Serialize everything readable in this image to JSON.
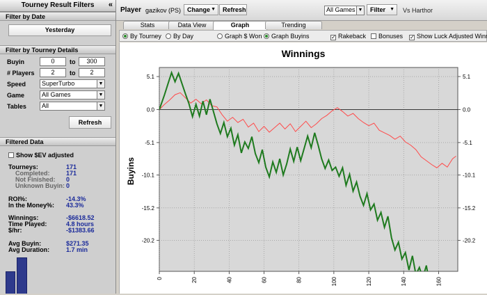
{
  "left": {
    "title": "Tourney Result Filters",
    "collapse_glyph": "«",
    "filter_by_date": {
      "header": "Filter by Date",
      "button": "Yesterday"
    },
    "filter_by_details": {
      "header": "Filter by Tourney Details",
      "buyin": {
        "label": "Buyin",
        "from": "0",
        "to_label": "to",
        "to": "300"
      },
      "players": {
        "label": "# Players",
        "from": "2",
        "to_label": "to",
        "to": "2"
      },
      "speed": {
        "label": "Speed",
        "value": "SuperTurbo"
      },
      "game": {
        "label": "Game",
        "value": "All Games"
      },
      "tables": {
        "label": "Tables",
        "value": "All"
      },
      "refresh": "Refresh"
    },
    "filtered": {
      "header": "Filtered Data",
      "show_ev_label": "Show $EV adjusted",
      "tourneys": {
        "label": "Tourneys:",
        "value": "171"
      },
      "completed": {
        "label": "Completed:",
        "value": "171"
      },
      "not_finished": {
        "label": "Not Finished:",
        "value": "0"
      },
      "unknown_buyin": {
        "label": "Unknown Buyin:",
        "value": "0"
      },
      "roi": {
        "label": "ROI%:",
        "value": "-14.3%"
      },
      "itm": {
        "label": "In the Money%:",
        "value": "43.3%"
      },
      "winnings": {
        "label": "Winnings:",
        "value": "-$6618.52"
      },
      "time_played": {
        "label": "Time Played:",
        "value": "4.8 hours"
      },
      "per_hour": {
        "label": "$/hr:",
        "value": "-$1383.66"
      },
      "avg_buyin": {
        "label": "Avg Buyin:",
        "value": "$271.35"
      },
      "avg_duration": {
        "label": "Avg Duration:",
        "value": "1.7 min"
      }
    }
  },
  "topbar": {
    "player_label": "Player",
    "player_name": "gazikov (PS)",
    "change": "Change",
    "refresh": "Refresh",
    "games": "All Games",
    "filter": "Filter",
    "vs": "Vs Harthor"
  },
  "tabs": [
    {
      "label": "Stats"
    },
    {
      "label": "Data View"
    },
    {
      "label": "Graph"
    },
    {
      "label": "Trending"
    }
  ],
  "options": {
    "by_tourney": "By Tourney",
    "by_day": "By Day",
    "graph_won": "Graph $ Won",
    "graph_buyins": "Graph Buyins",
    "rakeback": "Rakeback",
    "bonuses": "Bonuses",
    "luck": "Show Luck Adjusted Winnings"
  },
  "colors": {
    "actual_line": "#1e7a1e",
    "luck_line": "#ff4a4a",
    "plot_bg": "#d8d8d8",
    "value_text": "#1a2a9a"
  },
  "chart_data": {
    "type": "line",
    "title": "Winnings",
    "ylabel": "Buyins",
    "xlabel": "",
    "xlim": [
      0,
      171
    ],
    "ylim": [
      -25,
      6.5
    ],
    "xticks": [
      0,
      20,
      40,
      60,
      80,
      100,
      120,
      140,
      160
    ],
    "yticks": [
      5.1,
      0.0,
      -5.1,
      -10.1,
      -15.2,
      -20.2
    ],
    "ytick_labels": [
      "5.1",
      "0.0",
      "-5.1",
      "-10.1",
      "-15.2",
      "-20.2"
    ],
    "grid": true,
    "series": [
      {
        "color": "#1e7a1e",
        "x": [
          0,
          3,
          5,
          7,
          9,
          11,
          13,
          15,
          17,
          19,
          21,
          23,
          25,
          27,
          29,
          31,
          33,
          35,
          37,
          39,
          41,
          43,
          45,
          47,
          49,
          51,
          53,
          55,
          57,
          59,
          61,
          63,
          65,
          67,
          69,
          71,
          73,
          75,
          77,
          79,
          81,
          83,
          85,
          87,
          89,
          91,
          93,
          95,
          97,
          99,
          101,
          103,
          105,
          107,
          109,
          111,
          113,
          115,
          117,
          119,
          121,
          123,
          125,
          127,
          129,
          131,
          133,
          135,
          137,
          139,
          141,
          143,
          145,
          147,
          149,
          151,
          153,
          155,
          157,
          159,
          161,
          163,
          165,
          167,
          170
        ],
        "y": [
          0.0,
          2.3,
          4.0,
          5.7,
          4.3,
          5.6,
          4.0,
          2.4,
          0.9,
          -1.1,
          0.8,
          -1.0,
          1.3,
          -0.8,
          1.6,
          -0.3,
          -2.2,
          -3.7,
          -2.0,
          -4.2,
          -2.9,
          -5.5,
          -3.9,
          -6.7,
          -5.0,
          -6.0,
          -4.2,
          -6.8,
          -8.2,
          -6.2,
          -8.9,
          -10.4,
          -8.1,
          -9.7,
          -7.6,
          -10.1,
          -8.4,
          -6.1,
          -8.0,
          -5.8,
          -7.9,
          -6.0,
          -4.1,
          -5.9,
          -3.6,
          -5.5,
          -7.6,
          -9.1,
          -7.8,
          -9.4,
          -8.9,
          -10.3,
          -9.0,
          -11.7,
          -10.0,
          -12.6,
          -11.2,
          -13.4,
          -14.8,
          -13.0,
          -15.5,
          -14.6,
          -17.1,
          -15.9,
          -18.2,
          -16.5,
          -19.8,
          -21.7,
          -20.5,
          -23.1,
          -22.1,
          -24.8,
          -22.6,
          -25.5,
          -24.4,
          -26.0,
          -24.1,
          -27.1,
          -25.6,
          -27.8,
          -26.3,
          -28.6,
          -27.3,
          -29.0,
          -27.8
        ],
        "name": ""
      },
      {
        "color": "#ff4a4a",
        "x": [
          0,
          3,
          6,
          9,
          12,
          15,
          18,
          21,
          24,
          27,
          30,
          33,
          36,
          39,
          42,
          45,
          48,
          51,
          54,
          57,
          60,
          63,
          66,
          69,
          72,
          75,
          78,
          81,
          84,
          87,
          90,
          93,
          96,
          99,
          102,
          105,
          108,
          111,
          114,
          117,
          120,
          123,
          126,
          129,
          132,
          135,
          138,
          141,
          144,
          147,
          150,
          153,
          156,
          159,
          162,
          165,
          168,
          170
        ],
        "y": [
          0.0,
          0.8,
          1.5,
          2.3,
          2.6,
          1.8,
          1.0,
          1.6,
          0.9,
          1.5,
          0.6,
          0.4,
          -0.8,
          -1.8,
          -1.2,
          -2.0,
          -1.5,
          -2.7,
          -2.1,
          -3.4,
          -2.6,
          -3.5,
          -2.8,
          -2.1,
          -3.0,
          -2.2,
          -3.4,
          -2.6,
          -1.8,
          -2.8,
          -2.2,
          -1.4,
          -0.9,
          -0.2,
          0.3,
          -0.3,
          -1.0,
          -0.6,
          -1.4,
          -2.0,
          -2.5,
          -2.1,
          -3.2,
          -3.6,
          -4.0,
          -4.6,
          -4.1,
          -5.0,
          -5.5,
          -6.2,
          -7.3,
          -7.9,
          -8.5,
          -9.0,
          -8.3,
          -8.9,
          -7.6,
          -7.2
        ],
        "name": ""
      }
    ]
  }
}
